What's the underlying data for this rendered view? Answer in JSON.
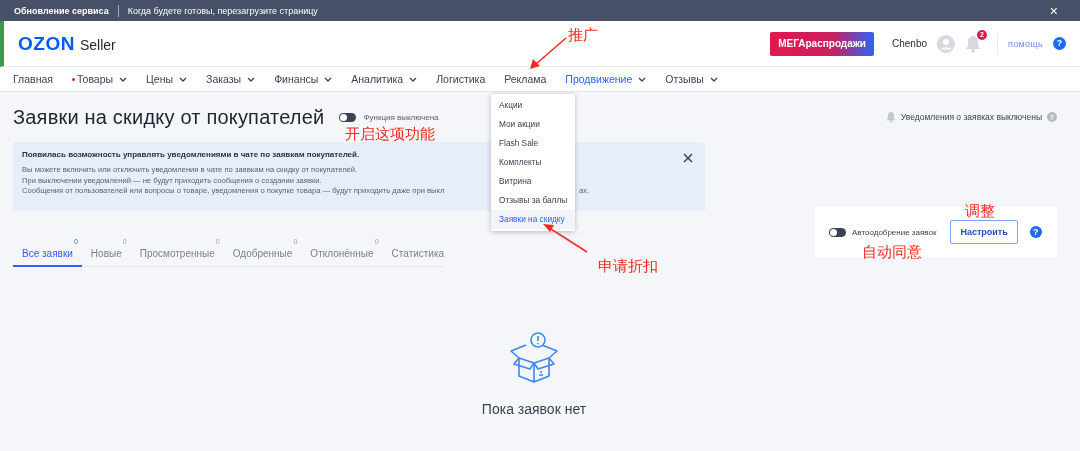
{
  "service_bar": {
    "title": "Обновление сервиса",
    "message": "Когда будете готовы, перезагрузите страницу",
    "close": "×"
  },
  "header": {
    "logo": "OZON",
    "logo_suffix": "Seller",
    "promo_button": "МЕГАраспродажи",
    "user": "Chenbo",
    "notifications": "2",
    "help": "помощь",
    "help_mark": "?"
  },
  "nav": [
    {
      "label": "Главная",
      "selected": false,
      "menu": false,
      "dot": false
    },
    {
      "label": "Товары",
      "selected": false,
      "menu": true,
      "dot": true
    },
    {
      "label": "Цены",
      "selected": false,
      "menu": true,
      "dot": false
    },
    {
      "label": "Заказы",
      "selected": false,
      "menu": true,
      "dot": false
    },
    {
      "label": "Финансы",
      "selected": false,
      "menu": true,
      "dot": false
    },
    {
      "label": "Аналитика",
      "selected": false,
      "menu": true,
      "dot": false
    },
    {
      "label": "Логистика",
      "selected": false,
      "menu": false,
      "dot": false
    },
    {
      "label": "Реклама",
      "selected": false,
      "menu": false,
      "dot": false
    },
    {
      "label": "Продвижение",
      "selected": true,
      "menu": true,
      "dot": false
    },
    {
      "label": "Отзывы",
      "selected": false,
      "menu": true,
      "dot": false
    }
  ],
  "dropdown": [
    {
      "label": "Акции",
      "selected": false
    },
    {
      "label": "Мои акции",
      "selected": false
    },
    {
      "label": "Flash Sale",
      "selected": false
    },
    {
      "label": "Комплекты",
      "selected": false
    },
    {
      "label": "Витрина",
      "selected": false
    },
    {
      "label": "Отзывы за баллы",
      "selected": false
    },
    {
      "label": "Заявки на скидку",
      "selected": true
    }
  ],
  "page": {
    "title": "Заявки на скидку от покупателей",
    "feature_toggle": {
      "label": "Функция выключена",
      "on": false
    },
    "notifications_status": "Уведомления о заявках выключены",
    "help_mark": "?"
  },
  "banner": {
    "heading": "Появилась возможность управлять уведомлениями в чате по заявкам покупателей.",
    "lines": [
      "Вы можете включить или отключить уведомления в чате по заявкам на скидку от покупателей.",
      "При выключении уведомлений — не будут приходить сообщения о создании заявки.",
      "Сообщения от пользователей или вопросы о товаре, уведомления о покупке товара — будут приходить даже при выкл"
    ],
    "tail": "ах."
  },
  "tabs": [
    {
      "label": "Все заявки",
      "count": "0",
      "selected": true
    },
    {
      "label": "Новые",
      "count": "0",
      "selected": false
    },
    {
      "label": "Просмотренные",
      "count": "0",
      "selected": false
    },
    {
      "label": "Одобренные",
      "count": "0",
      "selected": false
    },
    {
      "label": "Отклонённые",
      "count": "0",
      "selected": false
    },
    {
      "label": "Статистика",
      "selected": false
    }
  ],
  "auto_approve": {
    "label": "Автоодобрение заявок",
    "on": false,
    "button": "Настроить",
    "help_mark": "?"
  },
  "empty_state": "Пока заявок нет",
  "annotations": [
    {
      "kind": "promo",
      "text": "推广"
    },
    {
      "kind": "toggle",
      "text": "开启这项功能"
    },
    {
      "kind": "discount",
      "text": "申请折扣"
    },
    {
      "kind": "adjust",
      "text": "调整"
    },
    {
      "kind": "auto",
      "text": "自动同意"
    }
  ]
}
